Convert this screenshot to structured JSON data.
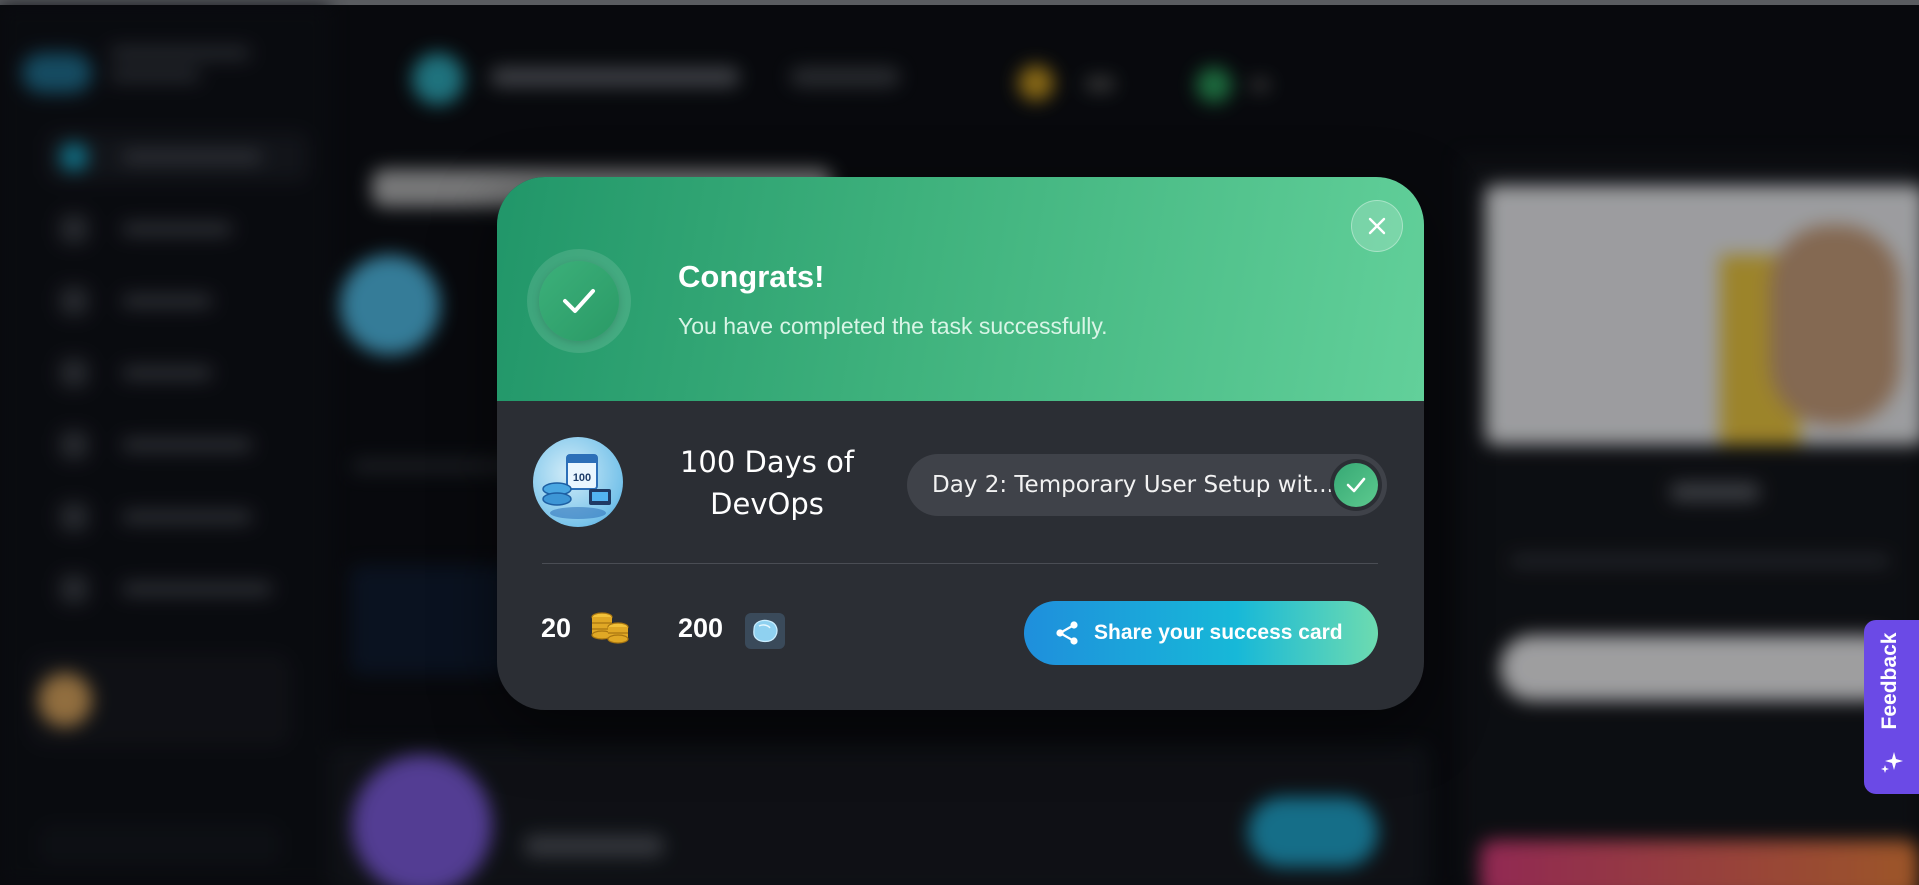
{
  "modal": {
    "title": "Congrats!",
    "subtitle": "You have completed the task successfully.",
    "course_title": "100 Days of DevOps",
    "task_label": "Day 2: Temporary User Setup wit...",
    "coins": "20",
    "gems": "200",
    "share_label": "Share your success card",
    "course_icon_text": "100"
  },
  "feedback": {
    "label": "Feedback"
  },
  "colors": {
    "header_gradient_start": "#219669",
    "header_gradient_end": "#62d09a",
    "modal_body": "#2b2e34",
    "share_gradient_start": "#1f8fdc",
    "share_gradient_end": "#6ddbb0",
    "feedback_bg": "#6b4ae6"
  },
  "icons": [
    "check-icon",
    "close-icon",
    "coins-icon",
    "gem-icon",
    "share-icon",
    "sparkle-icon"
  ]
}
